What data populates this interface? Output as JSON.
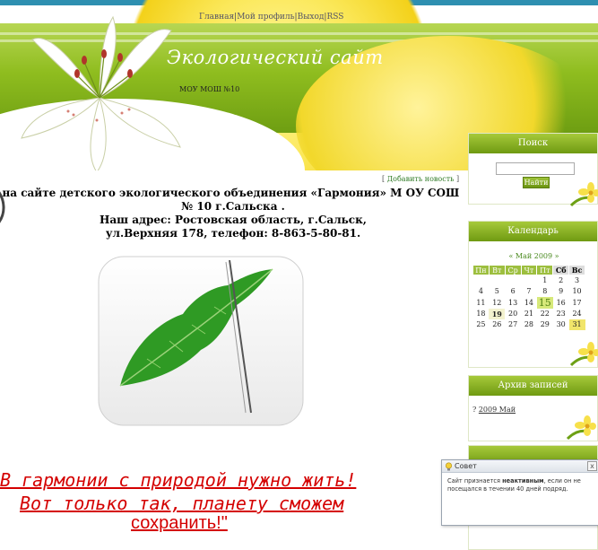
{
  "nav": {
    "home": "Главная",
    "profile": "Мой профиль",
    "logout": "Выход",
    "rss": "RSS",
    "sep": "|"
  },
  "site": {
    "title": "Экологический сайт",
    "subtitle": "МОУ МОШ №10"
  },
  "main": {
    "add_news": "Добавить новость",
    "welcome_line1": "тесь на сайте детского экологического объединения «Гармония» М ОУ СОШ",
    "welcome_line2": "№ 10 г.Сальска .",
    "welcome_line3": "Наш адрес: Ростовская область, г.Сальск,",
    "welcome_line4": "ул.Верхняя 178, телефон: 8-863-5-80-81.",
    "slogan_line1": "В гармонии с природой нужно жить!",
    "slogan_line2": "Вот только так, планету сможем",
    "slogan_line3": "сохранить!\""
  },
  "sidebar": {
    "search": {
      "title": "Поиск",
      "button": "Найти",
      "value": ""
    },
    "calendar": {
      "title": "Календарь",
      "prev": "«",
      "next": "»",
      "month": "Май 2009",
      "weekdays": [
        "Пн",
        "Вт",
        "Ср",
        "Чт",
        "Пт",
        "Сб",
        "Вс"
      ],
      "weeks": [
        [
          "",
          "",
          "",
          "",
          "1",
          "2",
          "3"
        ],
        [
          "4",
          "5",
          "6",
          "7",
          "8",
          "9",
          "10"
        ],
        [
          "11",
          "12",
          "13",
          "14",
          "15",
          "16",
          "17"
        ],
        [
          "18",
          "19",
          "20",
          "21",
          "22",
          "23",
          "24"
        ],
        [
          "25",
          "26",
          "27",
          "28",
          "29",
          "30",
          "31"
        ]
      ],
      "today": "15",
      "selected": "19"
    },
    "archive": {
      "title": "Архив записей",
      "item": "2009 Май"
    }
  },
  "popup": {
    "title": "Совет",
    "text_before": "Сайт признается ",
    "text_bold": "неактивным",
    "text_after": ", если он не посещался в течении 40 дней подряд.",
    "close": "x"
  },
  "colors": {
    "accent_green": "#8fbd1f",
    "yellow": "#f3d11a",
    "slogan_red": "#d40000"
  }
}
